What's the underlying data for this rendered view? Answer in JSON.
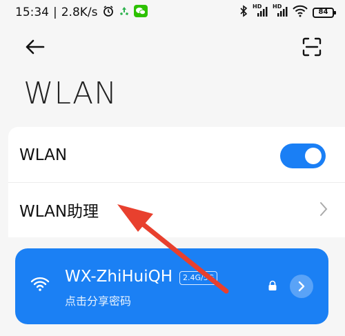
{
  "status_bar": {
    "time": "15:34",
    "separator": "|",
    "net_speed": "2.8K/s",
    "icons": [
      "alarm-icon",
      "recycle-icon",
      "wechat-icon",
      "bluetooth-icon",
      "signal-hd-1-icon",
      "signal-hd-2-icon",
      "wifi-icon",
      "battery-icon"
    ],
    "hd1": "HD",
    "hd2": "HD",
    "battery": "84"
  },
  "toolbar": {
    "back_icon": "arrow-left-icon",
    "scan_icon": "scan-icon"
  },
  "page": {
    "title": "WLAN"
  },
  "settings": {
    "wlan_label": "WLAN",
    "wlan_enabled": true,
    "assistant_label": "WLAN助理"
  },
  "network": {
    "ssid": "WX-ZhiHuiQH",
    "band": "2.4G/5G",
    "hint": "点击分享密码",
    "secured": true
  },
  "colors": {
    "accent": "#1b80f4",
    "annotation_arrow": "#e8402e"
  }
}
